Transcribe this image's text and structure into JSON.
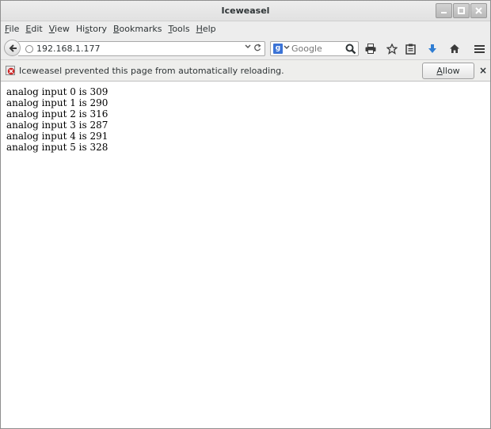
{
  "window": {
    "title": "Iceweasel"
  },
  "menu": [
    {
      "label_acc": "F",
      "label_rest": "ile"
    },
    {
      "label_acc": "E",
      "label_rest": "dit"
    },
    {
      "label_acc": "V",
      "label_rest": "iew"
    },
    {
      "label_pre": "Hi",
      "label_acc": "s",
      "label_rest": "tory"
    },
    {
      "label_acc": "B",
      "label_rest": "ookmarks"
    },
    {
      "label_acc": "T",
      "label_rest": "ools"
    },
    {
      "label_acc": "H",
      "label_rest": "elp"
    }
  ],
  "nav": {
    "url": "192.168.1.177",
    "search_placeholder": "Google"
  },
  "notification": {
    "message": "Iceweasel prevented this page from automatically reloading.",
    "allow_acc": "A",
    "allow_rest": "llow",
    "close_glyph": "×"
  },
  "content": {
    "lines": [
      "analog input 0 is 309",
      "analog input 1 is 290",
      "analog input 2 is 316",
      "analog input 3 is 287",
      "analog input 4 is 291",
      "analog input 5 is 328"
    ]
  },
  "icons": {
    "minimize": "minimize-icon",
    "maximize": "maximize-icon",
    "close": "close-icon",
    "back": "back-arrow-icon",
    "globe": "globe-icon",
    "reload": "reload-icon",
    "search_go": "magnifier-icon",
    "print": "print-icon",
    "bookmark": "star-icon",
    "reading_list": "clipboard-icon",
    "downloads": "download-arrow-icon",
    "home": "home-icon",
    "menu": "hamburger-menu-icon",
    "notify": "blocked-refresh-icon"
  },
  "colors": {
    "download_blue": "#2f7dd3",
    "notify_red": "#cc2222",
    "google_blue": "#3b73d6"
  }
}
